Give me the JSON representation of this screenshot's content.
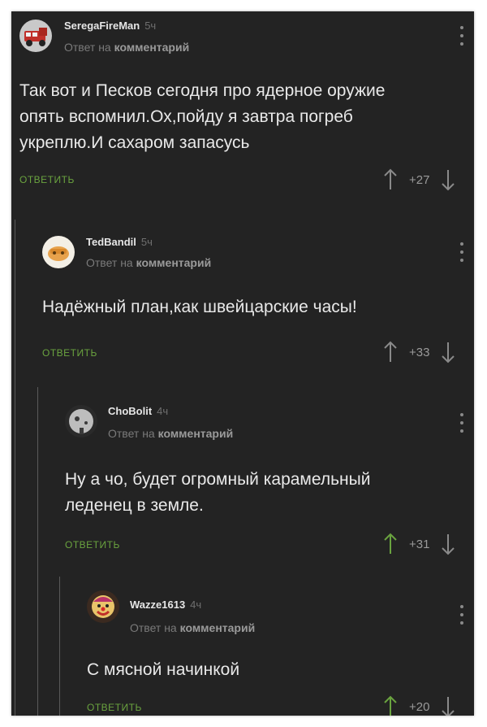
{
  "reply_meta_prefix": "Ответ на",
  "reply_meta_link": "комментарий",
  "reply_label": "ОТВЕТИТЬ",
  "colors": {
    "background": "#232323",
    "reply_green": "#6aa33f",
    "upvote_active": "#6aa33f",
    "arrow_gray": "#8a8a8a"
  },
  "comments": [
    {
      "username": "SeregaFireMan",
      "time": "5ч",
      "text": "Так вот и Песков сегодня про ядерное оружие\nопять вспомнил.Ох,пойду я завтра погреб\nукреплю.И сахаром запасусь",
      "score": "+27",
      "upvoted": false,
      "avatar_icon": "fire-truck-avatar"
    },
    {
      "username": "TedBandil",
      "time": "5ч",
      "text": "Надёжный план,как швейцарские часы!",
      "score": "+33",
      "upvoted": false,
      "avatar_icon": "cartoon-avatar"
    },
    {
      "username": "ChoBolit",
      "time": "4ч",
      "text": "Ну а чо, будет огромный карамельный\nледенец в земле.",
      "score": "+31",
      "upvoted": true,
      "avatar_icon": "gray-sphere-avatar"
    },
    {
      "username": "Wazze1613",
      "time": "4ч",
      "text": "С мясной начинкой",
      "score": "+20",
      "upvoted": true,
      "avatar_icon": "clown-avatar"
    }
  ]
}
